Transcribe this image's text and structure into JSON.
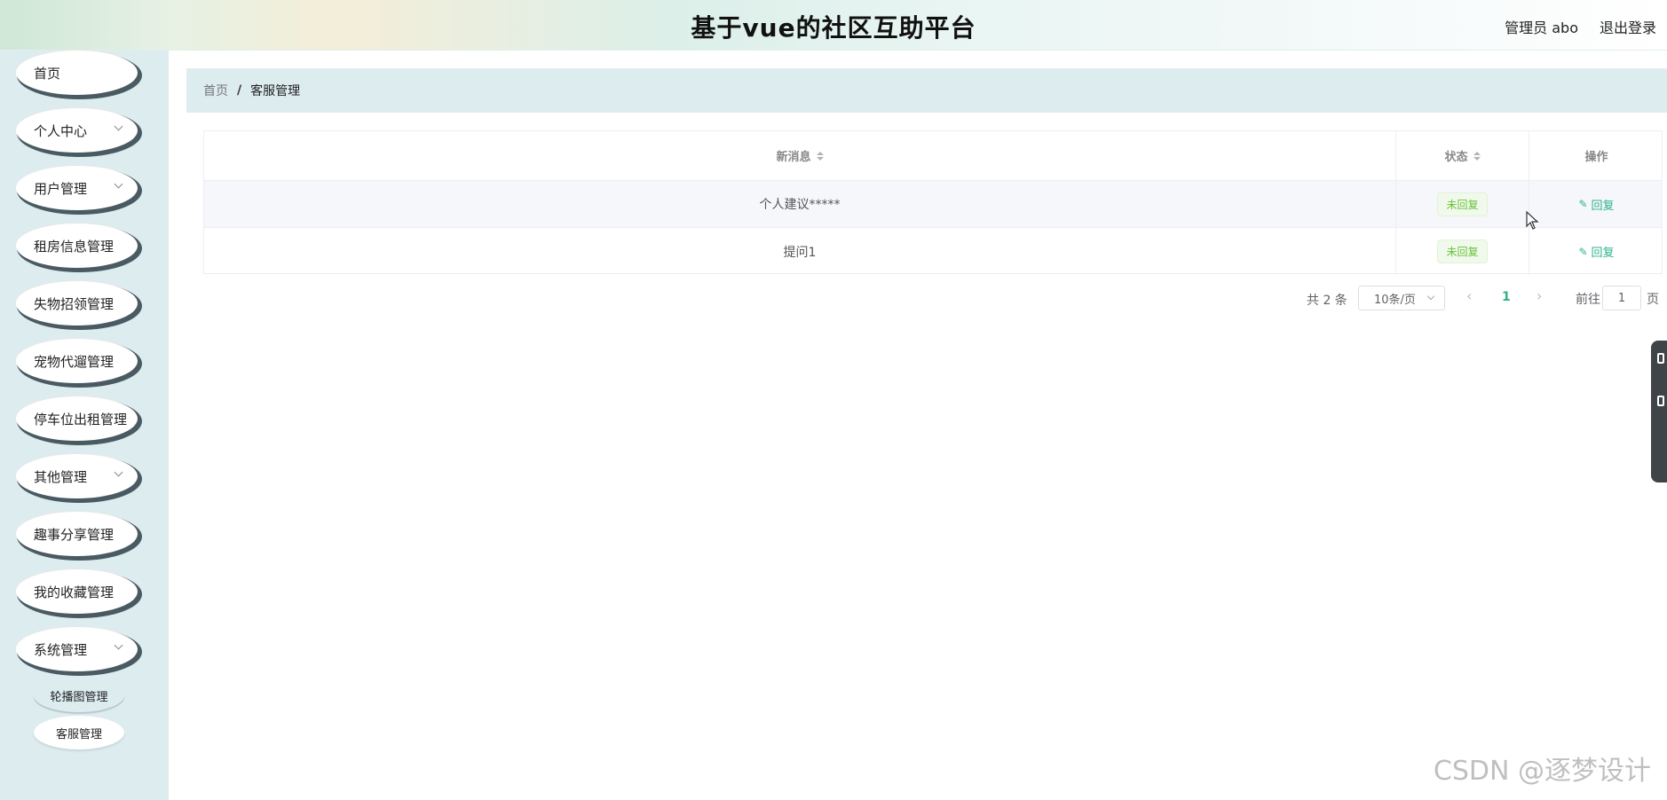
{
  "header": {
    "title": "基于vue的社区互助平台",
    "user": "管理员 abo",
    "logout": "退出登录"
  },
  "sidebar": {
    "items": [
      {
        "label": "首页",
        "has_children": false
      },
      {
        "label": "个人中心",
        "has_children": true
      },
      {
        "label": "用户管理",
        "has_children": true
      },
      {
        "label": "租房信息管理",
        "has_children": true
      },
      {
        "label": "失物招领管理",
        "has_children": true
      },
      {
        "label": "宠物代遛管理",
        "has_children": true
      },
      {
        "label": "停车位出租管理",
        "has_children": true
      },
      {
        "label": "其他管理",
        "has_children": true
      },
      {
        "label": "趣事分享管理",
        "has_children": true
      },
      {
        "label": "我的收藏管理",
        "has_children": true
      },
      {
        "label": "系统管理",
        "has_children": true
      }
    ],
    "subitems": [
      {
        "label": "轮播图管理"
      },
      {
        "label": "客服管理"
      }
    ]
  },
  "breadcrumb": {
    "home": "首页",
    "separator": "/",
    "current": "客服管理"
  },
  "table": {
    "columns": [
      "新消息",
      "状态",
      "操作"
    ],
    "rows": [
      {
        "message": "个人建议*****",
        "status": "未回复",
        "action": "回复"
      },
      {
        "message": "提问1",
        "status": "未回复",
        "action": "回复"
      }
    ]
  },
  "pagination": {
    "total": "共 2 条",
    "page_size": "10条/页",
    "current_page": "1",
    "goto_label": "前往",
    "goto_value": "1",
    "page_unit": "页"
  },
  "watermark": "CSDN @逐梦设计",
  "colors": {
    "accent": "#2fb28c",
    "sidebar_bg": "#dcecef",
    "tag_green": "#67c23a"
  }
}
